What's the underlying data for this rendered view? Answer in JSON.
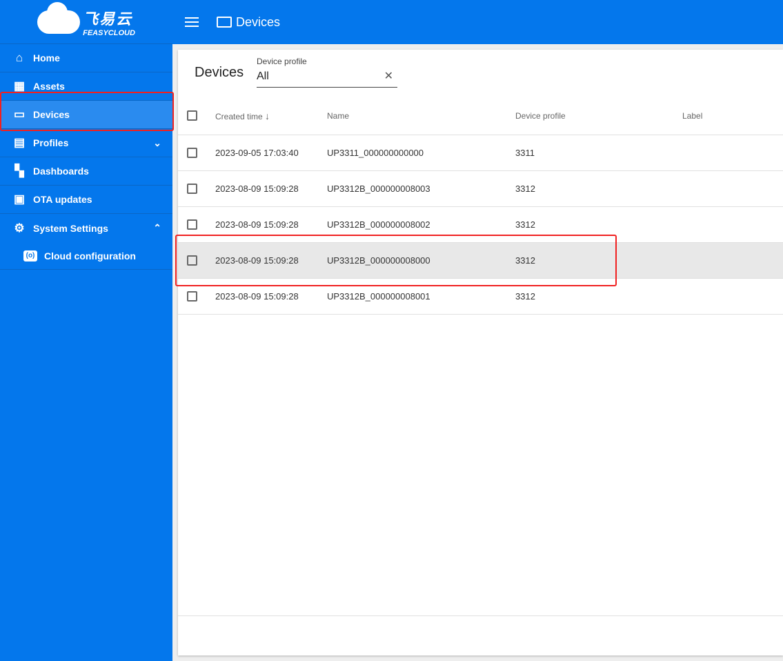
{
  "logo": {
    "cn": "飞易云",
    "en": "FEASYCLOUD"
  },
  "sidebar": {
    "items": [
      {
        "label": "Home",
        "icon": "home-icon"
      },
      {
        "label": "Assets",
        "icon": "building-icon"
      },
      {
        "label": "Devices",
        "icon": "devices-icon"
      },
      {
        "label": "Profiles",
        "icon": "badge-icon"
      },
      {
        "label": "Dashboards",
        "icon": "dashboard-icon"
      },
      {
        "label": "OTA updates",
        "icon": "chip-icon"
      },
      {
        "label": "System Settings",
        "icon": "gear-icon"
      }
    ],
    "sub": {
      "label": "Cloud configuration",
      "icon": "cloud-config-icon"
    }
  },
  "header": {
    "title": "Devices"
  },
  "main": {
    "title": "Devices",
    "filter": {
      "label": "Device profile",
      "value": "All"
    },
    "columns": [
      "Created time",
      "Name",
      "Device profile",
      "Label"
    ],
    "rows": [
      {
        "time": "2023-09-05 17:03:40",
        "name": "UP3311_000000000000",
        "profile": "3311",
        "label": ""
      },
      {
        "time": "2023-08-09 15:09:28",
        "name": "UP3312B_000000008003",
        "profile": "3312",
        "label": ""
      },
      {
        "time": "2023-08-09 15:09:28",
        "name": "UP3312B_000000008002",
        "profile": "3312",
        "label": ""
      },
      {
        "time": "2023-08-09 15:09:28",
        "name": "UP3312B_000000008000",
        "profile": "3312",
        "label": ""
      },
      {
        "time": "2023-08-09 15:09:28",
        "name": "UP3312B_000000008001",
        "profile": "3312",
        "label": ""
      }
    ]
  }
}
